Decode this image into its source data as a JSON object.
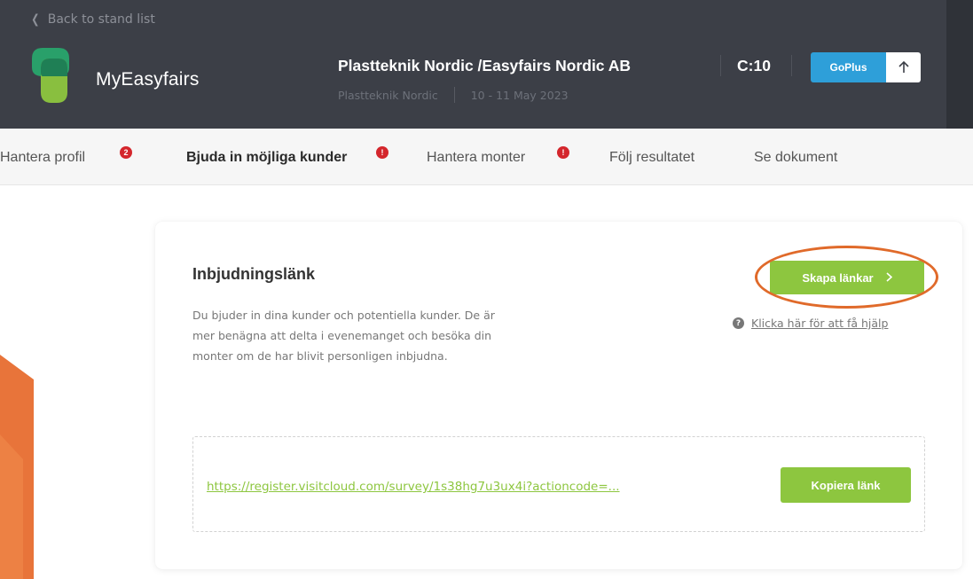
{
  "header": {
    "back_label": "Back to stand list",
    "app_name": "MyEasyfairs",
    "company": "Plastteknik Nordic /Easyfairs Nordic AB",
    "stand_code": "C:10",
    "event_name": "Plastteknik Nordic",
    "event_dates": "10 - 11 May 2023",
    "plan_label": "GoPlus",
    "icons": [
      "chevron-left-icon",
      "arrow-up-icon"
    ],
    "colors": {
      "background": "#3c3f47",
      "plan_blue": "#2e9fd9"
    }
  },
  "tabs": [
    {
      "label": "Hantera profil",
      "badge": "2",
      "active": false
    },
    {
      "label": "Bjuda in möjliga kunder",
      "badge": "!",
      "active": true
    },
    {
      "label": "Hantera monter",
      "badge": "!",
      "active": false
    },
    {
      "label": "Följ resultatet",
      "badge": "",
      "active": false
    },
    {
      "label": "Se dokument",
      "badge": "",
      "active": false
    }
  ],
  "card": {
    "title": "Inbjudningslänk",
    "description": "Du bjuder in dina kunder och potentiella kunder. De är mer benägna att delta i evenemanget och besöka din monter om de har blivit personligen inbjudna.",
    "create_button": "Skapa länkar",
    "help_text": "Klicka här för att få hjälp",
    "invite_url": "https://register.visitcloud.com/survey/1s38hg7u3ux4i?actioncode=...",
    "copy_button": "Kopiera länk",
    "colors": {
      "accent_green": "#8dc63f",
      "highlight_orange": "#e06a2a",
      "badge_red": "#d4262c"
    }
  }
}
